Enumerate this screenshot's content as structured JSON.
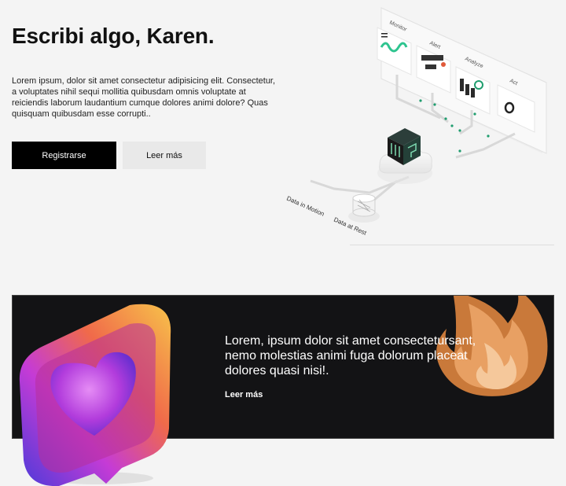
{
  "hero": {
    "title": "Escribi algo, Karen.",
    "text": "Lorem ipsum, dolor sit amet consectetur adipisicing elit. Consectetur, a voluptates nihil sequi mollitia quibusdam omnis voluptate at reiciendis laborum laudantium cumque dolores animi dolore? Quas quisquam quibusdam esse corrupti..",
    "primary_button": "Registrarse",
    "secondary_button": "Leer más"
  },
  "illustration": {
    "labels": [
      "Monitor",
      "Alert",
      "Analyze",
      "Act"
    ],
    "data_in_motion": "Data in Motion",
    "data_at_rest": "Data at Rest"
  },
  "banner": {
    "text": "Lorem, ipsum dolor sit amet consectetursant, nemo molestias animi fuga dolorum placeat dolores quasi nisi!.",
    "link": "Leer más"
  },
  "colors": {
    "accent": "#1f9d6e",
    "banner_bg": "#131315"
  }
}
